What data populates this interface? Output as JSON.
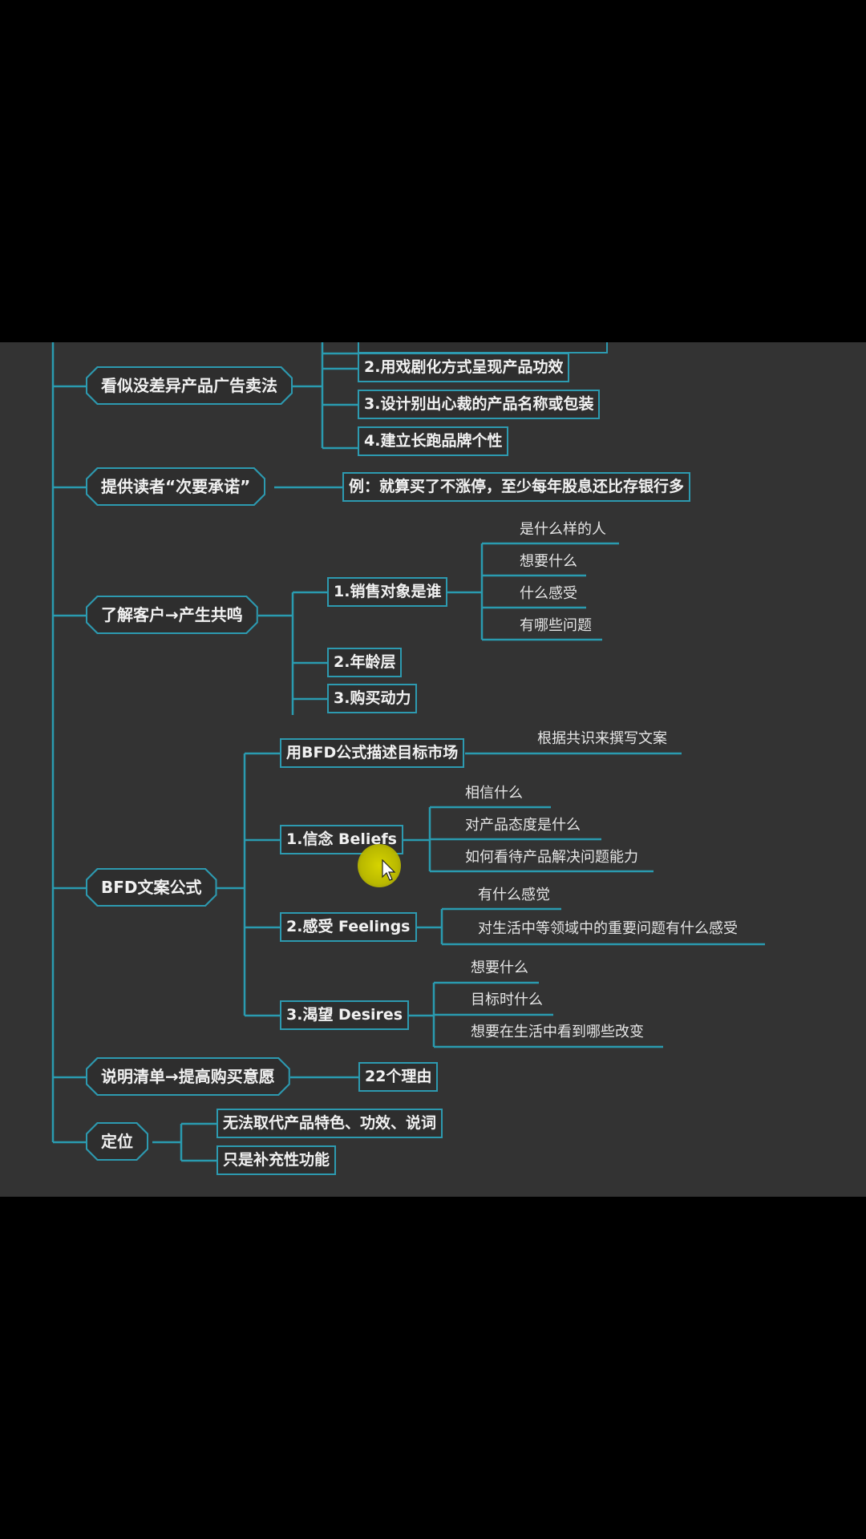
{
  "colors": {
    "background": "#333333",
    "line": "#2a9bb0",
    "text": "#f1f1f1",
    "letterbox": "#000000"
  },
  "mindmap": {
    "partial_top_box": "",
    "group1": {
      "label": "看似没差异产品广告卖法",
      "children": [
        "2.用戏剧化方式呈现产品功效",
        "3.设计别出心裁的产品名称或包装",
        "4.建立长跑品牌个性"
      ]
    },
    "group2": {
      "label": "提供读者“次要承诺”",
      "children": [
        "例：就算买了不涨停，至少每年股息还比存银行多"
      ]
    },
    "group3": {
      "label": "了解客户→产生共鸣",
      "children": [
        {
          "label": "1.销售对象是谁",
          "leaves": [
            "是什么样的人",
            "想要什么",
            "什么感受",
            "有哪些问题"
          ]
        },
        {
          "label": "2.年龄层"
        },
        {
          "label": "3.购买动力"
        }
      ]
    },
    "group4": {
      "label": "BFD文案公式",
      "children": [
        {
          "label": "用BFD公式描述目标市场",
          "leaves": [
            "根据共识来撰写文案"
          ]
        },
        {
          "label": "1.信念 Beliefs",
          "leaves": [
            "相信什么",
            "对产品态度是什么",
            "如何看待产品解决问题能力"
          ]
        },
        {
          "label": "2.感受 Feelings",
          "leaves": [
            "有什么感觉",
            "对生活中等领域中的重要问题有什么感受"
          ]
        },
        {
          "label": "3.渴望 Desires",
          "leaves": [
            "想要什么",
            "目标时什么",
            "想要在生活中看到哪些改变"
          ]
        }
      ]
    },
    "group5": {
      "label": "说明清单→提高购买意愿",
      "children": [
        "22个理由"
      ]
    },
    "group6": {
      "label": "定位",
      "children": [
        "无法取代产品特色、功效、说词",
        "只是补充性功能"
      ]
    }
  }
}
